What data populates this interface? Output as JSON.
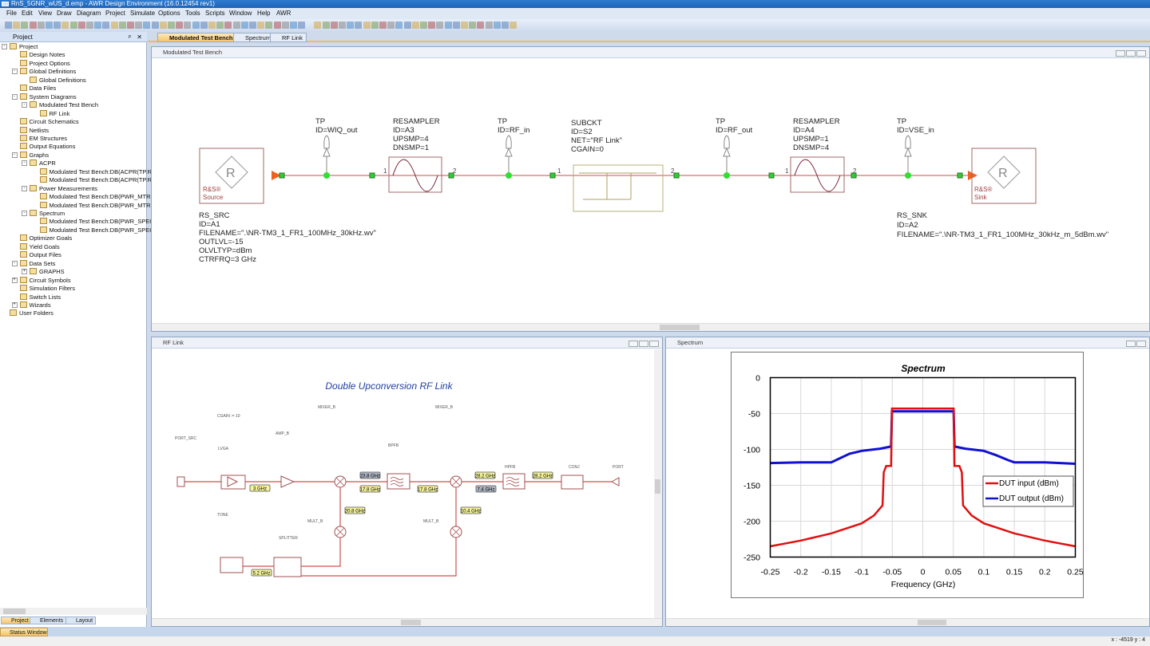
{
  "window_title": "RnS_5GNR_wUS_d.emp - AWR Design Environment (16.0.12454 rev1)",
  "menu": [
    "File",
    "Edit",
    "View",
    "Draw",
    "Diagram",
    "Project",
    "Simulate",
    "Options",
    "Tools",
    "Scripts",
    "Window",
    "Help",
    "AWR"
  ],
  "project_panel": {
    "title": "Project",
    "items": [
      {
        "label": "Project",
        "level": 0,
        "expander": "-"
      },
      {
        "label": "Design Notes",
        "level": 1
      },
      {
        "label": "Project Options",
        "level": 1
      },
      {
        "label": "Global Definitions",
        "level": 1,
        "expander": "-"
      },
      {
        "label": "Global Definitions",
        "level": 2
      },
      {
        "label": "Data Files",
        "level": 1
      },
      {
        "label": "System Diagrams",
        "level": 1,
        "expander": "-"
      },
      {
        "label": "Modulated Test Bench",
        "level": 2,
        "expander": "-"
      },
      {
        "label": "RF Link",
        "level": 3
      },
      {
        "label": "Circuit Schematics",
        "level": 1
      },
      {
        "label": "Netlists",
        "level": 1
      },
      {
        "label": "EM Structures",
        "level": 1
      },
      {
        "label": "Output Equations",
        "level": 1
      },
      {
        "label": "Graphs",
        "level": 1,
        "expander": "-"
      },
      {
        "label": "ACPR",
        "level": 2,
        "expander": "-"
      },
      {
        "label": "Modulated Test Bench:DB(ACPR(TP.RF_",
        "level": 3
      },
      {
        "label": "Modulated Test Bench:DB(ACPR(TP.RF_",
        "level": 3
      },
      {
        "label": "Power Measurements",
        "level": 2,
        "expander": "-"
      },
      {
        "label": "Modulated Test Bench:DB(PWR_MTR(T",
        "level": 3
      },
      {
        "label": "Modulated Test Bench:DB(PWR_MTR(T",
        "level": 3
      },
      {
        "label": "Spectrum",
        "level": 2,
        "expander": "-"
      },
      {
        "label": "Modulated Test Bench:DB(PWR_SPEC(T",
        "level": 3
      },
      {
        "label": "Modulated Test Bench:DB(PWR_SPEC(T",
        "level": 3
      },
      {
        "label": "Optimizer Goals",
        "level": 1
      },
      {
        "label": "Yield Goals",
        "level": 1
      },
      {
        "label": "Output Files",
        "level": 1
      },
      {
        "label": "Data Sets",
        "level": 1,
        "expander": "-"
      },
      {
        "label": "GRAPHS",
        "level": 2,
        "expander": "+"
      },
      {
        "label": "Circuit Symbols",
        "level": 1,
        "expander": "+"
      },
      {
        "label": "Simulation Filters",
        "level": 1
      },
      {
        "label": "Switch Lists",
        "level": 1
      },
      {
        "label": "Wizards",
        "level": 1,
        "expander": "+"
      },
      {
        "label": "User Folders",
        "level": 0
      }
    ],
    "bottom_tabs": [
      "Project",
      "Elements",
      "Layout"
    ]
  },
  "doc_tabs": [
    "Modulated Test Bench",
    "Spectrum",
    "RF Link"
  ],
  "test_bench": {
    "title": "Modulated Test Bench",
    "source": {
      "logo": "R&S® Source",
      "lines": [
        "RS_SRC",
        "ID=A1",
        "FILENAME=\".\\NR-TM3_1_FR1_100MHz_30kHz.wv\"",
        "OUTLVL=-15",
        "OLVLTYP=dBm",
        "CTRFRQ=3 GHz"
      ],
      "mark1": "R&S®",
      "mark2": "Source"
    },
    "tp1": [
      "TP",
      "ID=WIQ_out"
    ],
    "resampler1": [
      "RESAMPLER",
      "ID=A3",
      "UPSMP=4",
      "DNSMP=1"
    ],
    "tp2": [
      "TP",
      "ID=RF_in"
    ],
    "subckt": [
      "SUBCKT",
      "ID=S2",
      "NET=\"RF Link\"",
      "CGAIN=0"
    ],
    "tp3": [
      "TP",
      "ID=RF_out"
    ],
    "resampler2": [
      "RESAMPLER",
      "ID=A4",
      "UPSMP=1",
      "DNSMP=4"
    ],
    "tp4": [
      "TP",
      "ID=VSE_in"
    ],
    "sink": {
      "lines": [
        "RS_SNK",
        "ID=A2",
        "FILENAME=\".\\NR-TM3_1_FR1_100MHz_30kHz_m_5dBm.wv\""
      ],
      "mark1": "R&S®",
      "mark2": "Sink"
    },
    "port_numbers": [
      "1",
      "2"
    ]
  },
  "rf_link": {
    "title": "RF Link",
    "heading": "Double Upconversion RF Link",
    "cgain": "CGAIN := 10",
    "blocks": {
      "port_src": "PORT_SRC",
      "lvga": "LVGA",
      "amp": "AMP_B",
      "mixer1": "MIXER_B",
      "bpf": "BPFB",
      "mixer2": "MIXER_B",
      "hpf": "HPFB",
      "conj": "CONJ",
      "port": "PORT",
      "tone": "TONE",
      "splitter": "SPLITTER",
      "mult1": "MULT_B",
      "mult2": "MULT_B"
    },
    "freq_tags": {
      "f3": "3 GHz",
      "f238": "23.8 GHz",
      "f178a": "17.8 GHz",
      "f178b": "17.8 GHz",
      "f282a": "28.2 GHz",
      "f74": "7.4 GHz",
      "f282b": "28.2 GHz",
      "f208": "20.8 GHz",
      "f104": "10.4 GHz",
      "f52": "5.2 GHz"
    }
  },
  "spectrum_window": {
    "title": "Spectrum"
  },
  "chart_data": {
    "type": "line",
    "title": "Spectrum",
    "xlabel": "Frequency (GHz)",
    "ylabel": "",
    "xlim": [
      -0.25,
      0.25
    ],
    "ylim": [
      -250,
      0
    ],
    "xticks": [
      "-0.25",
      "-0.2",
      "-0.15",
      "-0.1",
      "-0.05",
      "0",
      "0.05",
      "0.1",
      "0.15",
      "0.2",
      "0.25"
    ],
    "yticks": [
      "0",
      "-50",
      "-100",
      "-150",
      "-200",
      "-250"
    ],
    "grid": true,
    "legend": "right",
    "series": [
      {
        "name": "DUT input (dBm)",
        "color": "#e01010",
        "x": [
          -0.25,
          -0.2,
          -0.15,
          -0.1,
          -0.08,
          -0.066,
          -0.064,
          -0.06,
          -0.052,
          -0.0505,
          0.0505,
          0.052,
          0.06,
          0.064,
          0.066,
          0.08,
          0.1,
          0.15,
          0.2,
          0.25
        ],
        "y": [
          -235,
          -227,
          -217,
          -203,
          -192,
          -178,
          -132,
          -123,
          -123,
          -43,
          -43,
          -123,
          -123,
          -132,
          -178,
          -192,
          -203,
          -217,
          -227,
          -235
        ]
      },
      {
        "name": "DUT output (dBm)",
        "color": "#1010d0",
        "x": [
          -0.25,
          -0.2,
          -0.15,
          -0.14,
          -0.12,
          -0.1,
          -0.07,
          -0.052,
          -0.0505,
          0.0505,
          0.052,
          0.07,
          0.1,
          0.12,
          0.14,
          0.15,
          0.2,
          0.25
        ],
        "y": [
          -119,
          -118,
          -118,
          -114,
          -106,
          -102,
          -99,
          -96,
          -47,
          -47,
          -96,
          -99,
          -102,
          -108,
          -115,
          -118,
          -118,
          -120
        ]
      }
    ]
  },
  "status": {
    "window_tab": "Status Window",
    "coords": "x : -4519  y : 4"
  }
}
